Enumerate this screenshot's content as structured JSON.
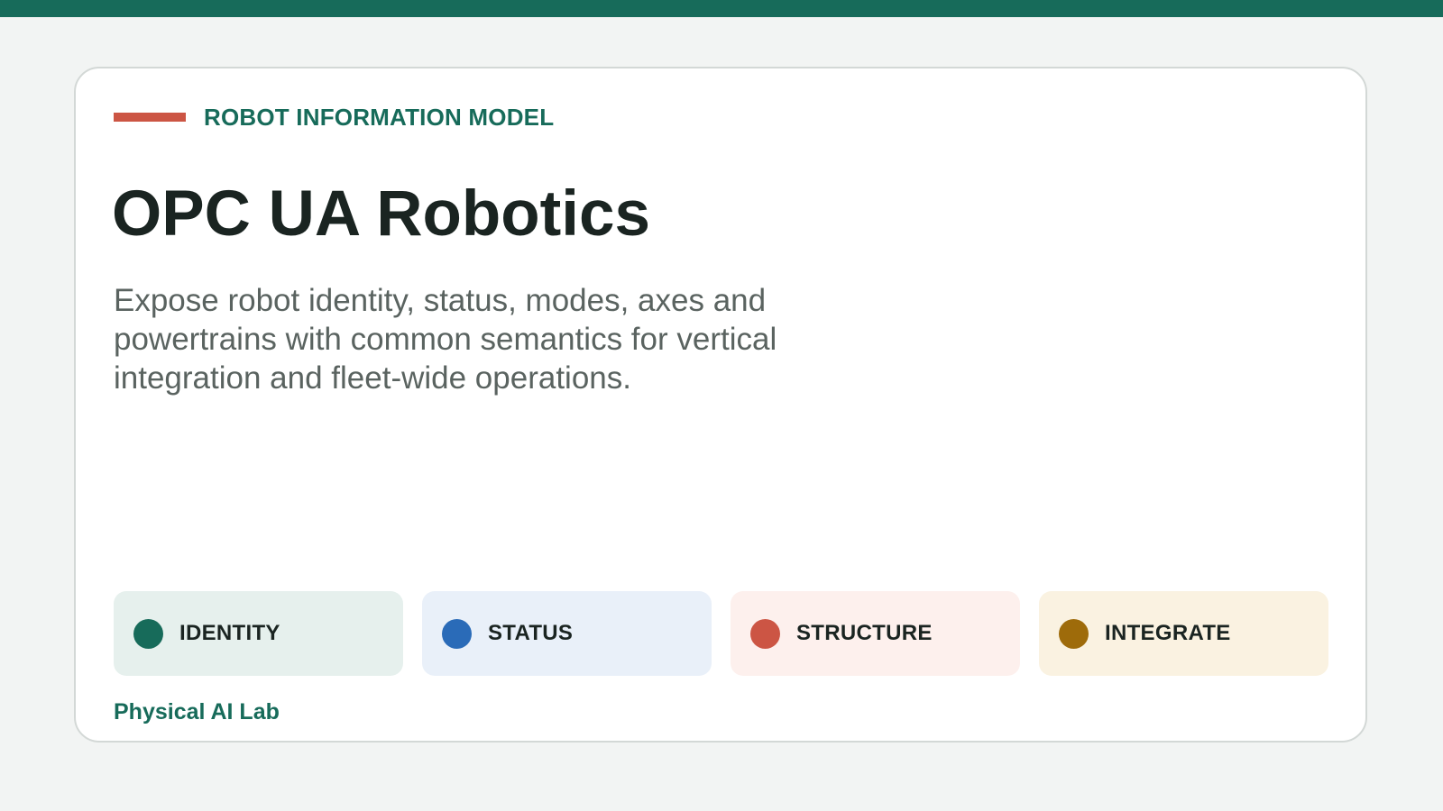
{
  "colors": {
    "brand": "#176b5a",
    "accent": "#cc5544",
    "background": "#f2f4f3"
  },
  "header": {
    "eyebrow": "ROBOT INFORMATION MODEL",
    "title": "OPC UA Robotics",
    "subtitle": "Expose robot identity, status, modes, axes and powertrains with common semantics for vertical integration and fleet-wide operations."
  },
  "pills": [
    {
      "label": "IDENTITY",
      "dot_color": "#176b5a",
      "bg_color": "#e6f0ed"
    },
    {
      "label": "STATUS",
      "dot_color": "#2a6bb8",
      "bg_color": "#e9f0f9"
    },
    {
      "label": "STRUCTURE",
      "dot_color": "#cc5544",
      "bg_color": "#fdf0ed"
    },
    {
      "label": "INTEGRATE",
      "dot_color": "#9e6b0a",
      "bg_color": "#faf2e1"
    }
  ],
  "footer": {
    "org": "Physical AI Lab"
  }
}
